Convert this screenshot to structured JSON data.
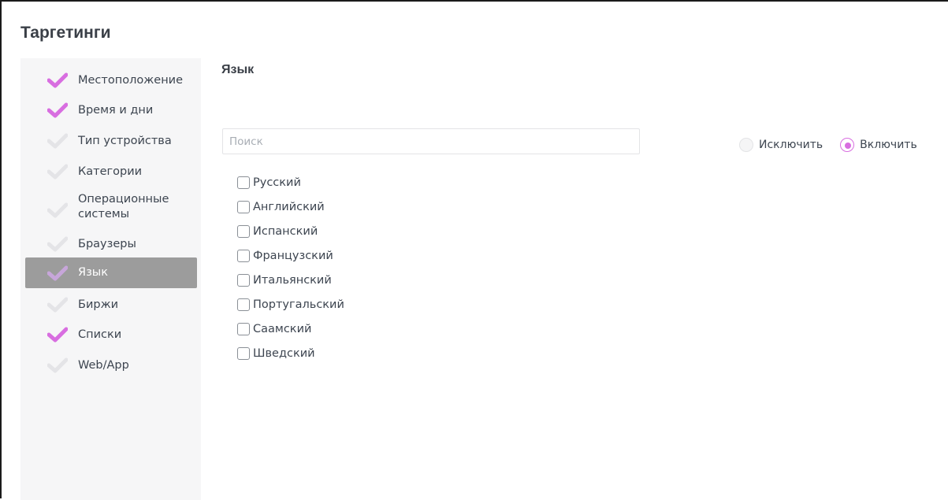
{
  "page": {
    "title": "Таргетинги"
  },
  "colors": {
    "accent": "#d86ee0",
    "inactive_check": "#e4e4e7",
    "active_bg": "#9c9c9c",
    "active_check": "#c7a6da"
  },
  "sidebar": {
    "items": [
      {
        "label": "Местоположение",
        "checked": true,
        "active": false
      },
      {
        "label": "Время и дни",
        "checked": true,
        "active": false
      },
      {
        "label": "Тип устройства",
        "checked": false,
        "active": false
      },
      {
        "label": "Категории",
        "checked": false,
        "active": false
      },
      {
        "label": "Операционные системы",
        "checked": false,
        "active": false
      },
      {
        "label": "Браузеры",
        "checked": false,
        "active": false
      },
      {
        "label": "Язык",
        "checked": false,
        "active": true
      },
      {
        "label": "Биржи",
        "checked": false,
        "active": false
      },
      {
        "label": "Списки",
        "checked": true,
        "active": false
      },
      {
        "label": "Web/App",
        "checked": false,
        "active": false
      }
    ]
  },
  "main": {
    "section_title": "Язык",
    "search": {
      "placeholder": "Поиск",
      "value": ""
    },
    "mode": {
      "exclude_label": "Исключить",
      "include_label": "Включить",
      "selected": "include"
    },
    "languages": [
      {
        "label": "Русский",
        "checked": false
      },
      {
        "label": "Английский",
        "checked": false
      },
      {
        "label": "Испанский",
        "checked": false
      },
      {
        "label": "Французский",
        "checked": false
      },
      {
        "label": "Итальянский",
        "checked": false
      },
      {
        "label": "Португальский",
        "checked": false
      },
      {
        "label": "Саамский",
        "checked": false
      },
      {
        "label": "Шведский",
        "checked": false
      }
    ]
  }
}
